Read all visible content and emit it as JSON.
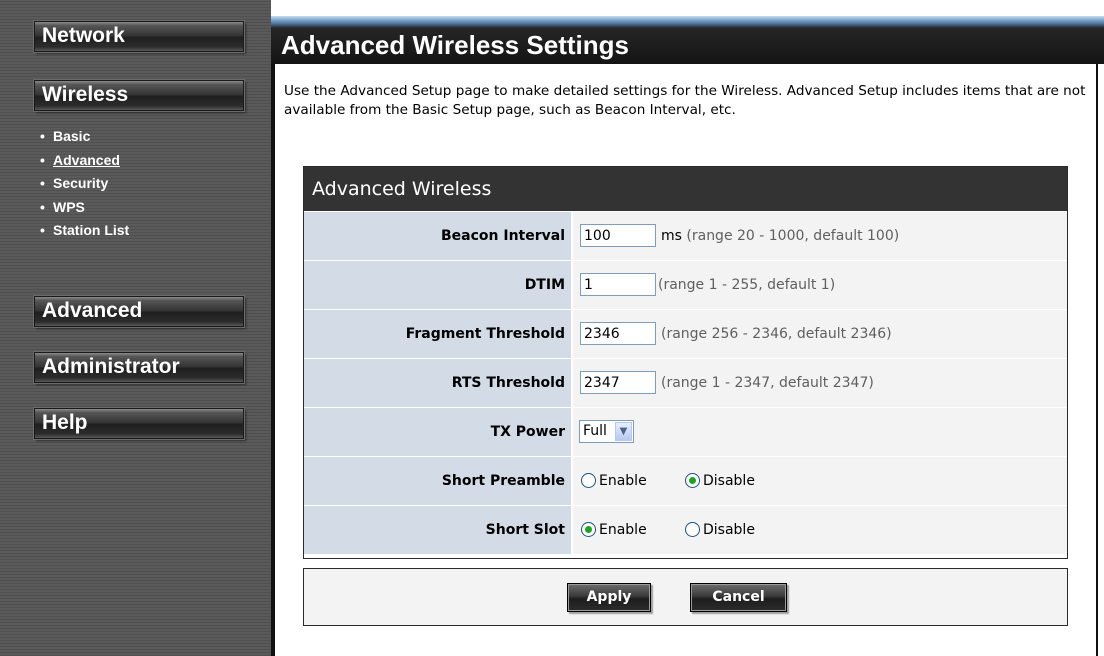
{
  "sidebar": {
    "nav": {
      "network": "Network",
      "wireless": "Wireless",
      "advanced": "Advanced",
      "administrator": "Administrator",
      "help": "Help"
    },
    "wireless_items": [
      "Basic",
      "Advanced",
      "Security",
      "WPS",
      "Station List"
    ],
    "active_item": "Advanced"
  },
  "header": {
    "title": "Advanced Wireless Settings"
  },
  "intro": "Use the Advanced Setup page to make detailed settings for the Wireless. Advanced Setup includes items that are not available from the Basic Setup page, such as Beacon Interval, etc.",
  "form": {
    "title": "Advanced Wireless",
    "beacon_interval": {
      "label": "Beacon Interval",
      "value": "100",
      "unit": "ms",
      "hint": "(range 20 - 1000, default 100)"
    },
    "dtim": {
      "label": "DTIM",
      "value": "1",
      "hint": "(range 1 - 255, default 1)"
    },
    "fragment_threshold": {
      "label": "Fragment Threshold",
      "value": "2346",
      "hint": "(range 256 - 2346, default 2346)"
    },
    "rts_threshold": {
      "label": "RTS Threshold",
      "value": "2347",
      "hint": "(range 1 - 2347, default 2347)"
    },
    "tx_power": {
      "label": "TX Power",
      "selected": "Full"
    },
    "short_preamble": {
      "label": "Short Preamble",
      "enable": "Enable",
      "disable": "Disable",
      "selected": "Disable"
    },
    "short_slot": {
      "label": "Short Slot",
      "enable": "Enable",
      "disable": "Disable",
      "selected": "Enable"
    }
  },
  "buttons": {
    "apply": "Apply",
    "cancel": "Cancel"
  },
  "colors": {
    "sidebar_bg": "#555555",
    "label_cell_bg": "#d3dbe7",
    "value_cell_bg": "#f3f3f3",
    "header_bg": "#141414",
    "radio_checked": "#21a121"
  }
}
